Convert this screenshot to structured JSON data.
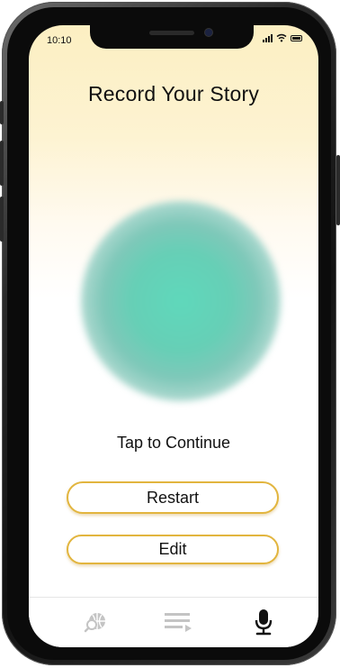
{
  "status_bar": {
    "time": "10:10"
  },
  "header": {
    "title": "Record Your Story"
  },
  "main": {
    "orb_icon": "record-orb",
    "tap_label": "Tap to Continue",
    "restart_label": "Restart",
    "edit_label": "Edit"
  },
  "tab_bar": {
    "items": [
      {
        "icon": "globe-search-icon",
        "active": false
      },
      {
        "icon": "playlist-icon",
        "active": false
      },
      {
        "icon": "microphone-icon",
        "active": true
      }
    ]
  },
  "colors": {
    "accent_border": "#e2b53e",
    "orb": "#5fd8bb",
    "inactive_icon": "#c4c4c4",
    "active_icon": "#111111"
  }
}
